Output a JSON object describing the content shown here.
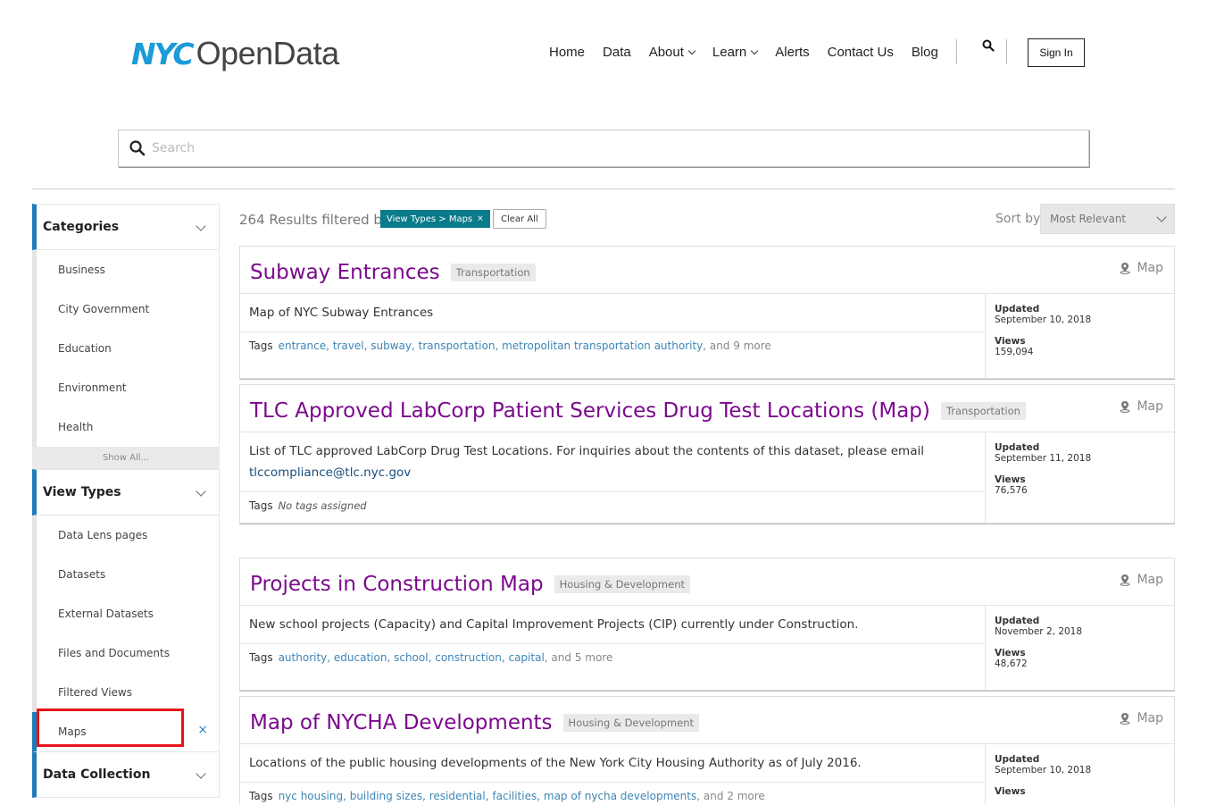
{
  "header": {
    "logo_nyc": "NYC",
    "logo_opendata": "OpenData",
    "nav": [
      {
        "label": "Home",
        "dropdown": false
      },
      {
        "label": "Data",
        "dropdown": false
      },
      {
        "label": "About",
        "dropdown": true
      },
      {
        "label": "Learn",
        "dropdown": true
      },
      {
        "label": "Alerts",
        "dropdown": false
      },
      {
        "label": "Contact Us",
        "dropdown": false
      },
      {
        "label": "Blog",
        "dropdown": false
      }
    ],
    "sign_in": "Sign In"
  },
  "search": {
    "placeholder": "Search"
  },
  "sidebar": {
    "categories": {
      "title": "Categories",
      "items": [
        "Business",
        "City Government",
        "Education",
        "Environment",
        "Health"
      ],
      "show_all": "Show All..."
    },
    "view_types": {
      "title": "View Types",
      "items": [
        "Data Lens pages",
        "Datasets",
        "External Datasets",
        "Files and Documents",
        "Filtered Views",
        "Maps"
      ],
      "active": "Maps",
      "remove_symbol": "×"
    },
    "data_collection": {
      "title": "Data Collection"
    }
  },
  "results": {
    "count_text": "264 Results filtered by",
    "filter_tag": "View Types > Maps",
    "filter_remove": "×",
    "clear_all": "Clear All",
    "sort_label": "Sort by",
    "sort_value": "Most Relevant",
    "items": [
      {
        "title": "Subway Entrances",
        "category": "Transportation",
        "type": "Map",
        "description": "Map of NYC Subway Entrances",
        "email": "",
        "tags_label": "Tags",
        "tags": [
          "entrance",
          "travel",
          "subway",
          "transportation",
          "metropolitan transportation authority"
        ],
        "more": ", and 9 more",
        "no_tags": "",
        "updated_label": "Updated",
        "updated": "September 10, 2018",
        "views_label": "Views",
        "views": "159,094"
      },
      {
        "title": "TLC Approved LabCorp Patient Services Drug Test Locations (Map)",
        "category": "Transportation",
        "type": "Map",
        "description": "List of TLC approved LabCorp Drug Test Locations. For inquiries about the contents of this dataset, please email",
        "email": "tlccompliance@tlc.nyc.gov",
        "tags_label": "Tags",
        "tags": [],
        "more": "",
        "no_tags": "No tags assigned",
        "updated_label": "Updated",
        "updated": "September 11, 2018",
        "views_label": "Views",
        "views": "76,576"
      },
      {
        "title": "Projects in Construction Map",
        "category": "Housing & Development",
        "type": "Map",
        "description": "New school projects (Capacity) and Capital Improvement Projects (CIP) currently under Construction.",
        "email": "",
        "tags_label": "Tags",
        "tags": [
          "authority",
          "education",
          "school",
          "construction",
          "capital"
        ],
        "more": ", and 5 more",
        "no_tags": "",
        "updated_label": "Updated",
        "updated": "November 2, 2018",
        "views_label": "Views",
        "views": "48,672"
      },
      {
        "title": "Map of NYCHA Developments",
        "category": "Housing & Development",
        "type": "Map",
        "description": "Locations of the public housing developments of the New York City Housing Authority as of July 2016.",
        "email": "",
        "tags_label": "Tags",
        "tags": [
          "nyc housing",
          "building sizes",
          "residential",
          "facilities",
          "map of nycha developments"
        ],
        "more": ", and 2 more",
        "no_tags": "",
        "updated_label": "Updated",
        "updated": "September 10, 2018",
        "views_label": "Views",
        "views": ""
      }
    ]
  },
  "colors": {
    "accent_blue": "#207bb8",
    "title_purple": "#7b0a8c",
    "filter_teal": "#0a7b8a",
    "highlight_red": "#e8141a"
  }
}
